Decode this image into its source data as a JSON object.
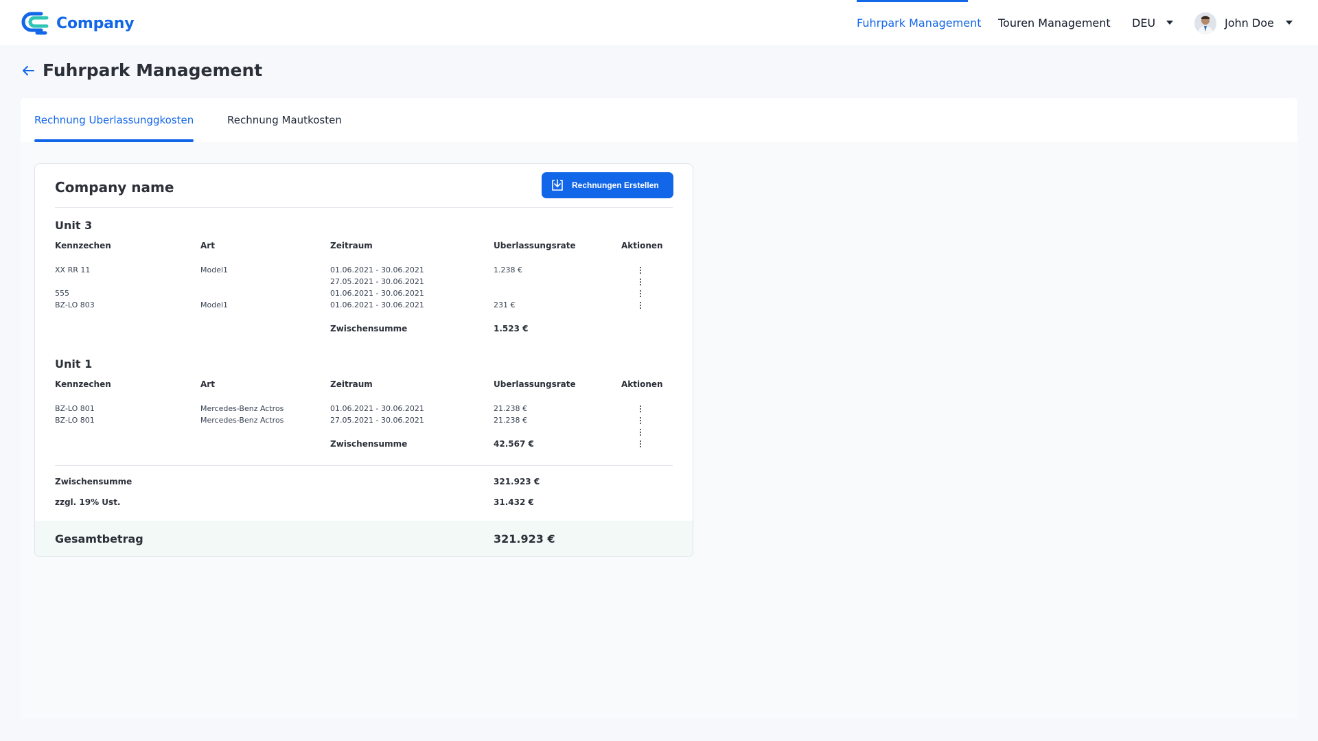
{
  "brand": {
    "name": "Company",
    "color": "#1267e8"
  },
  "nav": {
    "items": [
      {
        "label": "Fuhrpark Management",
        "active": true
      },
      {
        "label": "Touren Management",
        "active": false
      }
    ],
    "language": "DEU",
    "user": {
      "name": "John Doe"
    }
  },
  "page": {
    "title": "Fuhrpark Management"
  },
  "tabs": [
    {
      "label": "Rechnung Uberlassunggkosten",
      "active": true
    },
    {
      "label": "Rechnung Mautkosten",
      "active": false
    }
  ],
  "card": {
    "title": "Company name",
    "create_button": "Rechnungen Erstellen",
    "columns": [
      "Kennzechen",
      "Art",
      "Zeitraum",
      "Uberlassungsrate",
      "Aktionen"
    ],
    "units": [
      {
        "title": "Unit 3",
        "rows": [
          {
            "kennzeichen": "XX RR 11",
            "art": "Model1",
            "zeitraum": "01.06.2021 - 30.06.2021",
            "rate": "1.238 €"
          },
          {
            "kennzeichen": "",
            "art": "",
            "zeitraum": "27.05.2021 - 30.06.2021",
            "rate": ""
          },
          {
            "kennzeichen": "555",
            "art": "",
            "zeitraum": "01.06.2021 - 30.06.2021",
            "rate": ""
          },
          {
            "kennzeichen": "BZ-LO 803",
            "art": "Model1",
            "zeitraum": "01.06.2021 - 30.06.2021",
            "rate": "231 €"
          }
        ],
        "subtotal_label": "Zwischensumme",
        "subtotal": "1.523 €"
      },
      {
        "title": "Unit 1",
        "rows": [
          {
            "kennzeichen": "BZ-LO 801",
            "art": "Mercedes-Benz Actros",
            "zeitraum": "01.06.2021 - 30.06.2021",
            "rate": "21.238 €"
          },
          {
            "kennzeichen": "BZ-LO 801",
            "art": "Mercedes-Benz Actros",
            "zeitraum": "27.05.2021 - 30.06.2021",
            "rate": "21.238 €"
          }
        ],
        "subtotal_label": "Zwischensumme",
        "subtotal": "42.567 €"
      }
    ],
    "summary": {
      "subtotal_label": "Zwischensumme",
      "subtotal": "321.923 €",
      "vat_label": "zzgl. 19% Ust.",
      "vat": "31.432 €",
      "total_label": "Gesamtbetrag",
      "total": "321.923 €"
    }
  }
}
